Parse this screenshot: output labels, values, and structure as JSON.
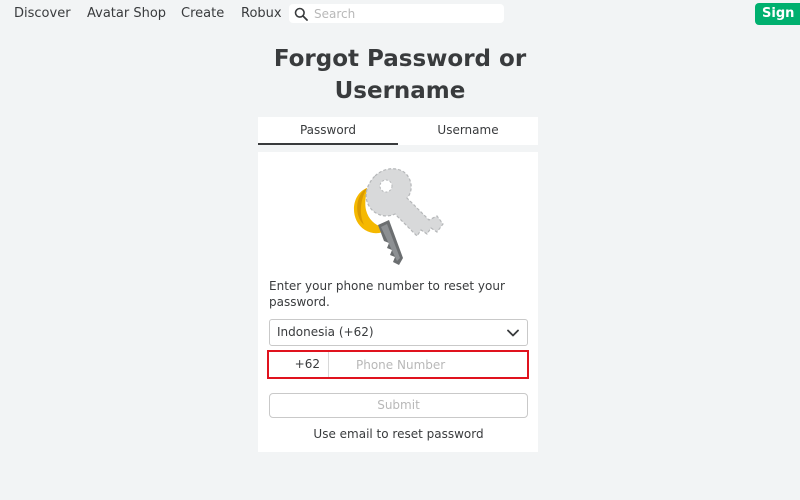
{
  "nav": {
    "items": [
      {
        "label": "Discover"
      },
      {
        "label": "Avatar Shop"
      },
      {
        "label": "Create"
      },
      {
        "label": "Robux"
      }
    ],
    "search": {
      "placeholder": "Search",
      "icon": "search-icon"
    },
    "signup_label": "Sign Up"
  },
  "page": {
    "title_line1": "Forgot Password or",
    "title_line2": "Username"
  },
  "tabs": [
    {
      "label": "Password",
      "active": true
    },
    {
      "label": "Username",
      "active": false
    }
  ],
  "form": {
    "illustration": "key-icon",
    "instructions": "Enter your phone number to reset your password.",
    "country_value": "Indonesia (+62)",
    "phone_prefix": "+62",
    "phone_placeholder": "Phone Number",
    "submit_label": "Submit",
    "email_link": "Use email to reset password"
  },
  "colors": {
    "accent_green": "#00b06f",
    "highlight_red": "#e0131e",
    "key_gold": "#f5b800",
    "text_dark": "#393b3d"
  }
}
